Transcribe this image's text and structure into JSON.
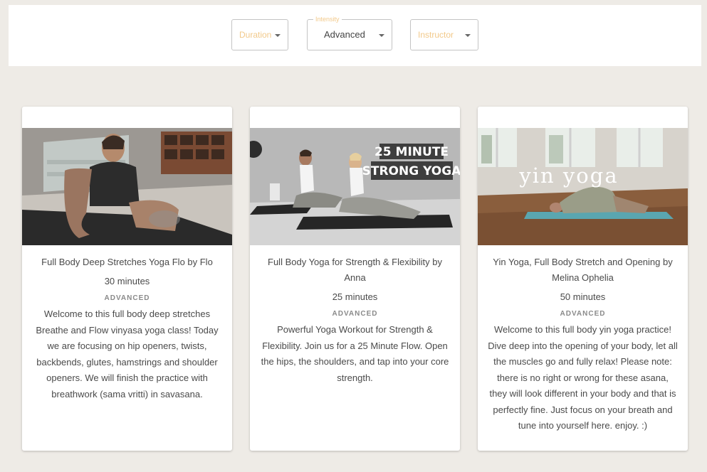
{
  "filters": {
    "duration": {
      "placeholder": "Duration"
    },
    "intensity": {
      "label": "Intensity",
      "value": "Advanced"
    },
    "instructor": {
      "placeholder": "Instructor"
    }
  },
  "cards": [
    {
      "title": "Full Body Deep Stretches Yoga Flo by Flo",
      "duration": "30 minutes",
      "level": "ADVANCED",
      "description": "Welcome to this full body deep stretches Breathe and Flow vinyasa yoga class! Today we are focusing on hip openers, twists, backbends, glutes, hamstrings and shoulder openers. We will finish the practice with breathwork (sama vritti) in savasana."
    },
    {
      "title": "Full Body Yoga for Strength & Flexibility by Anna",
      "duration": "25 minutes",
      "level": "ADVANCED",
      "description": "Powerful Yoga Workout for Strength & Flexibility. Join us for a 25 Minute Flow. Open the hips, the shoulders, and tap into your core strength.",
      "thumb_text": [
        "25 MINUTE",
        "STRONG YOGA"
      ]
    },
    {
      "title": "Yin Yoga, Full Body Stretch and Opening by Melina Ophelia",
      "duration": "50 minutes",
      "level": "ADVANCED",
      "description": "Welcome to this full body yin yoga practice! Dive deep into the opening of your body, let all the muscles go and fully relax! Please note: there is no right or wrong for these asana, they will look different in your body and that is perfectly fine. Just focus on your breath and tune into yourself here. enjoy. :)",
      "thumb_text": [
        "yin yoga"
      ]
    }
  ],
  "colors": {
    "page_bg": "#eeebe6",
    "accent_placeholder": "#f2c98a",
    "yoga_mat": "#2a2a2a",
    "mat_teal": "#5aa6b0"
  }
}
